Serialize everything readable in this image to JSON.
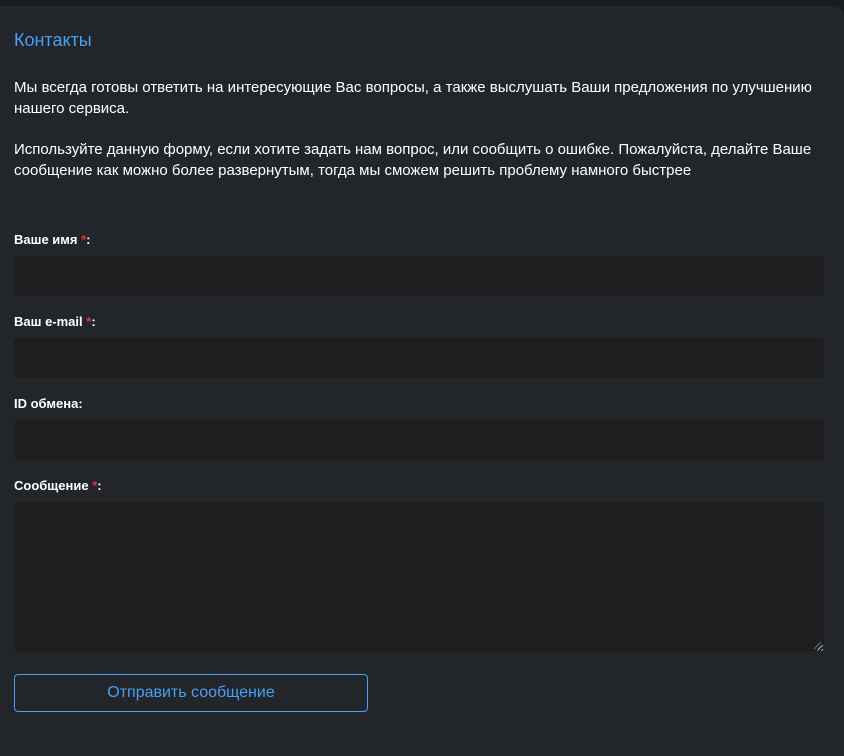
{
  "page": {
    "title": "Контакты",
    "intro": [
      "Мы всегда готовы ответить на интересующие Вас вопросы, а также выслушать Ваши предложения по улучшению нашего сервиса.",
      "Используйте данную форму, если хотите задать нам вопрос, или сообщить о ошибке. Пожалуйста, делайте Ваше сообщение как можно более развернутым, тогда мы сможем решить проблему намного быстрее"
    ]
  },
  "form": {
    "required_mark": "*",
    "name_label": "Ваше имя ",
    "name_value": "",
    "email_label": "Ваш e-mail ",
    "email_value": "",
    "exchange_id_label": "ID обмена:",
    "exchange_id_value": "",
    "message_label": "Сообщение ",
    "message_value": "",
    "label_suffix": ":",
    "submit_label": "Отправить сообщение"
  },
  "colors": {
    "accent": "#4a9ff5",
    "required": "#e5323a",
    "panel_bg": "#22262b",
    "input_bg": "#1e1e1f"
  }
}
